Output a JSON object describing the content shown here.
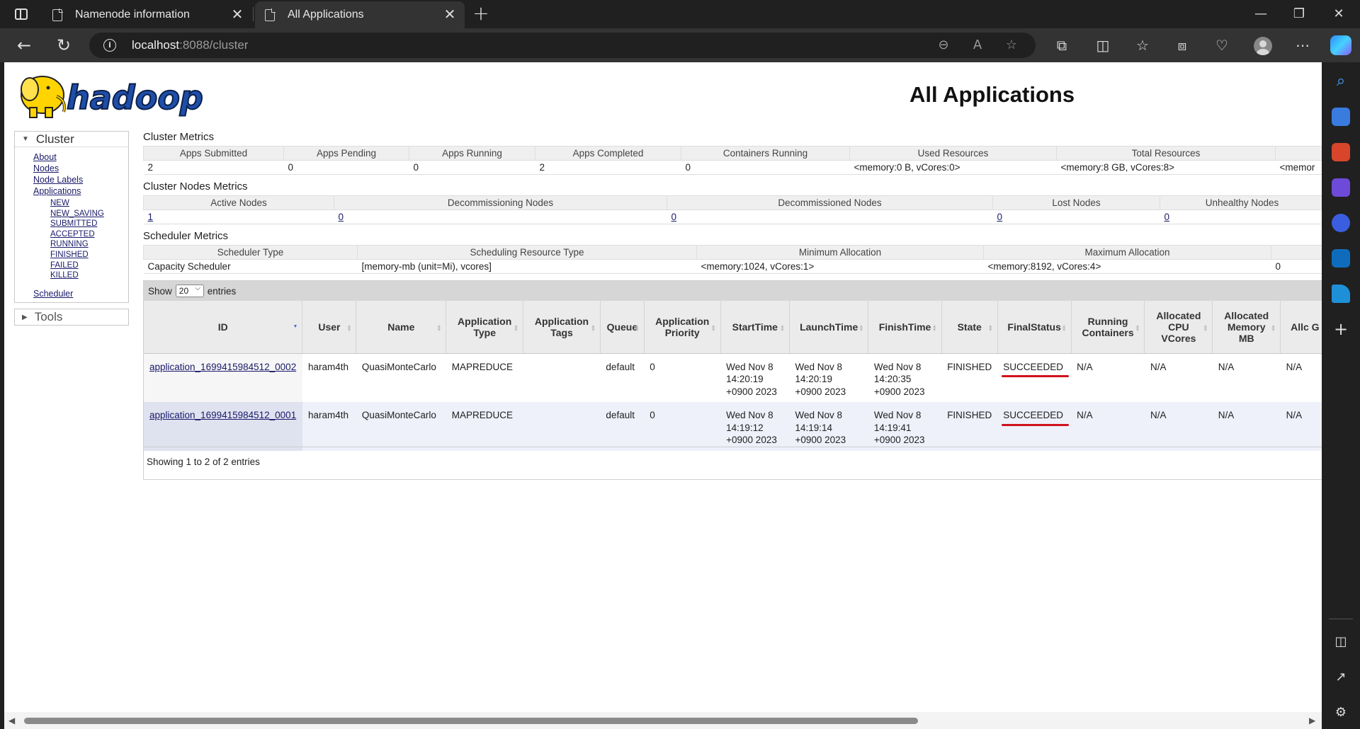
{
  "browser": {
    "tabs": [
      {
        "title": "Namenode information",
        "active": false
      },
      {
        "title": "All Applications",
        "active": true
      }
    ],
    "url_host": "localhost",
    "url_rest": ":8088/cluster"
  },
  "page": {
    "logo_text": "hadoop",
    "title": "All Applications"
  },
  "nav": {
    "cluster_label": "Cluster",
    "links": [
      "About",
      "Nodes",
      "Node Labels",
      "Applications"
    ],
    "app_states": [
      "NEW",
      "NEW_SAVING",
      "SUBMITTED",
      "ACCEPTED",
      "RUNNING",
      "FINISHED",
      "FAILED",
      "KILLED"
    ],
    "scheduler": "Scheduler",
    "tools_label": "Tools"
  },
  "cluster_metrics": {
    "title": "Cluster Metrics",
    "headers": [
      "Apps Submitted",
      "Apps Pending",
      "Apps Running",
      "Apps Completed",
      "Containers Running",
      "Used Resources",
      "Total Resources",
      ""
    ],
    "values": [
      "2",
      "0",
      "0",
      "2",
      "0",
      "<memory:0 B, vCores:0>",
      "<memory:8 GB, vCores:8>",
      "<memor"
    ]
  },
  "nodes_metrics": {
    "title": "Cluster Nodes Metrics",
    "headers": [
      "Active Nodes",
      "Decommissioning Nodes",
      "Decommissioned Nodes",
      "Lost Nodes",
      "Unhealthy Nodes"
    ],
    "values": [
      "1",
      "0",
      "0",
      "0",
      "0"
    ]
  },
  "scheduler_metrics": {
    "title": "Scheduler Metrics",
    "headers": [
      "Scheduler Type",
      "Scheduling Resource Type",
      "Minimum Allocation",
      "Maximum Allocation",
      ""
    ],
    "values": [
      "Capacity Scheduler",
      "[memory-mb (unit=Mi), vcores]",
      "<memory:1024, vCores:1>",
      "<memory:8192, vCores:4>",
      "0"
    ]
  },
  "apps_table": {
    "show_label": "Show",
    "page_size": "20",
    "entries_label": "entries",
    "headers": [
      "ID",
      "User",
      "Name",
      "Application Type",
      "Application Tags",
      "Queue",
      "Application Priority",
      "StartTime",
      "LaunchTime",
      "FinishTime",
      "State",
      "FinalStatus",
      "Running Containers",
      "Allocated CPU VCores",
      "Allocated Memory MB",
      "Allc G"
    ],
    "rows": [
      {
        "id": "application_1699415984512_0002",
        "user": "haram4th",
        "name": "QuasiMonteCarlo",
        "type": "MAPREDUCE",
        "tags": "",
        "queue": "default",
        "priority": "0",
        "start": [
          "Wed Nov 8",
          "14:20:19",
          "+0900 2023"
        ],
        "launch": [
          "Wed Nov 8",
          "14:20:19",
          "+0900 2023"
        ],
        "finish": [
          "Wed Nov 8",
          "14:20:35",
          "+0900 2023"
        ],
        "state": "FINISHED",
        "final_status": "SUCCEEDED",
        "running_containers": "N/A",
        "alloc_cpu": "N/A",
        "alloc_mem": "N/A",
        "alloc_g": "N/A"
      },
      {
        "id": "application_1699415984512_0001",
        "user": "haram4th",
        "name": "QuasiMonteCarlo",
        "type": "MAPREDUCE",
        "tags": "",
        "queue": "default",
        "priority": "0",
        "start": [
          "Wed Nov 8",
          "14:19:12",
          "+0900 2023"
        ],
        "launch": [
          "Wed Nov 8",
          "14:19:14",
          "+0900 2023"
        ],
        "finish": [
          "Wed Nov 8",
          "14:19:41",
          "+0900 2023"
        ],
        "state": "FINISHED",
        "final_status": "SUCCEEDED",
        "running_containers": "N/A",
        "alloc_cpu": "N/A",
        "alloc_mem": "N/A",
        "alloc_g": "N/A"
      }
    ],
    "footer": "Showing 1 to 2 of 2 entries"
  },
  "colors": {
    "annotation_underline": "#d0101a",
    "link": "#1a1a6a",
    "logo_yellow": "#ffd400"
  }
}
